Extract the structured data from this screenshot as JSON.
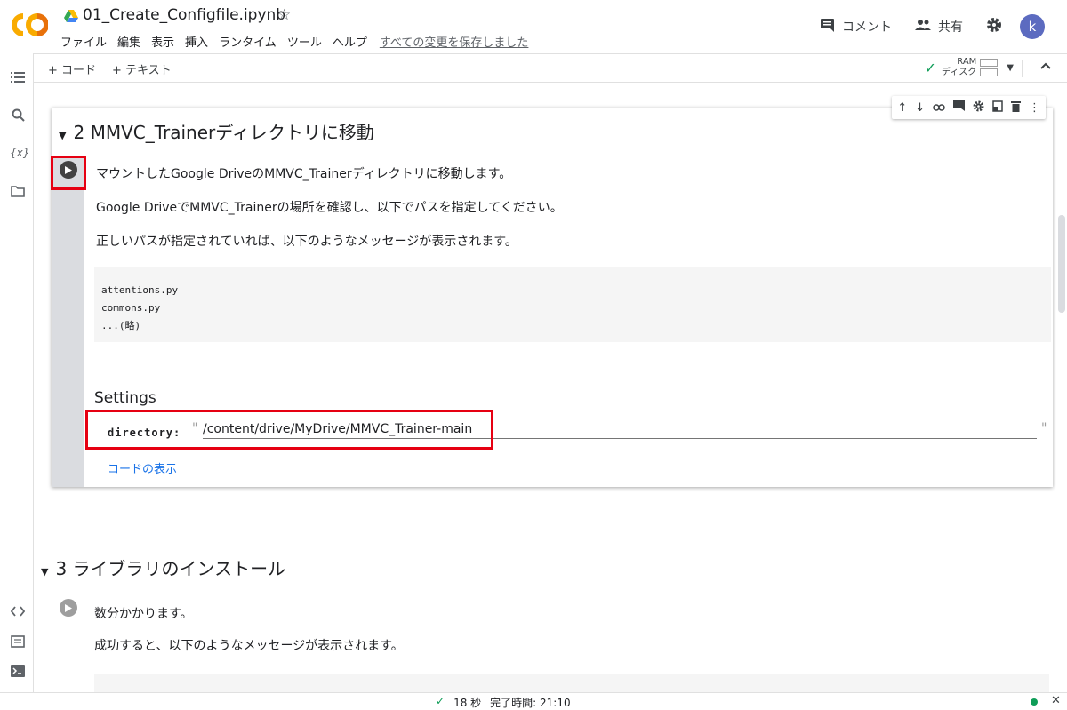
{
  "notebook": {
    "title": "01_Create_Configfile.ipynb"
  },
  "menu": [
    "ファイル",
    "編集",
    "表示",
    "挿入",
    "ランタイム",
    "ツール",
    "ヘルプ"
  ],
  "save_status": "すべての変更を保存しました",
  "header_right": {
    "comment": "コメント",
    "share": "共有",
    "avatar": "k"
  },
  "toolbar": {
    "add_code": "+ コード",
    "add_text": "+ テキスト",
    "ram": "RAM",
    "disk": "ディスク"
  },
  "cell1": {
    "heading_number": "2",
    "heading_text": "MMVC_Trainerディレクトリに移動",
    "para1": "マウントしたGoogle DriveのMMVC_Trainerディレクトリに移動します。",
    "para2": "Google DriveでMMVC_Trainerの場所を確認し、以下でパスを指定してください。",
    "para3": "正しいパスが指定されていれば、以下のようなメッセージが表示されます。",
    "code_lines": [
      "attentions.py",
      "commons.py",
      "...(略)"
    ],
    "settings_title": "Settings",
    "directory_label": "directory:",
    "directory_value": "/content/drive/MyDrive/MMVC_Trainer-main",
    "show_code": "コードの表示"
  },
  "cell2": {
    "heading_number": "3",
    "heading_text": "ライブラリのインストール",
    "para1": "数分かかります。",
    "para2": "成功すると、以下のようなメッセージが表示されます。"
  },
  "status": {
    "duration": "18 秒",
    "completed": "完了時間: 21:10"
  },
  "colors": {
    "accent": "#1a73e8",
    "highlight": "#e60012",
    "ok": "#0f9d58",
    "avatar": "#5c6bc0"
  }
}
